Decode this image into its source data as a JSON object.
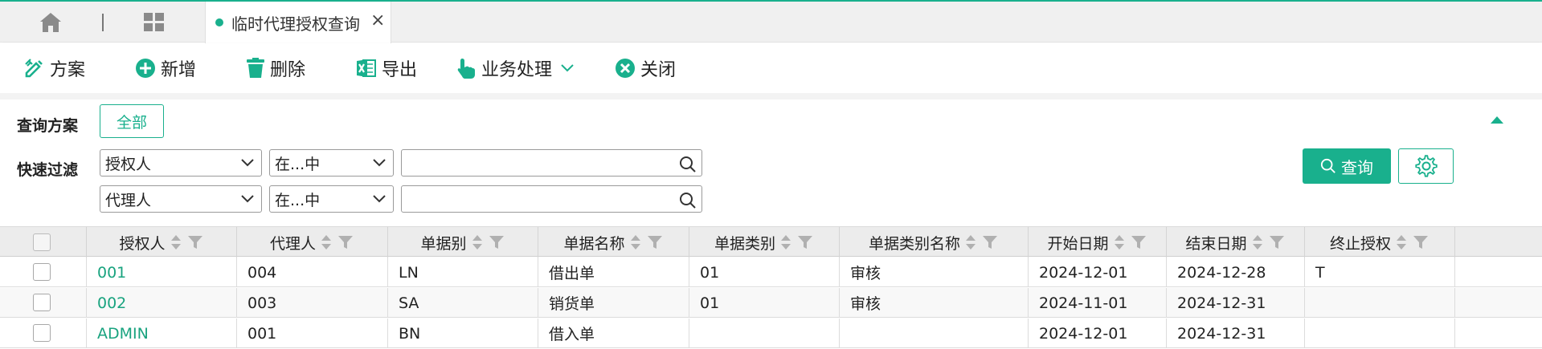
{
  "tabs": {
    "home_icon": "home-icon",
    "apps_icon": "grid-icon",
    "active": {
      "title": "临时代理授权查询",
      "close": "×"
    }
  },
  "toolbar": {
    "scheme": "方案",
    "add": "新增",
    "delete": "删除",
    "export": "导出",
    "business": "业务处理",
    "close": "关闭"
  },
  "filter": {
    "scheme_label": "查询方案",
    "scheme_all": "全部",
    "quick_label": "快速过滤",
    "rows": [
      {
        "field": "授权人",
        "operator": "在...中",
        "value": ""
      },
      {
        "field": "代理人",
        "operator": "在...中",
        "value": ""
      }
    ],
    "query_button": "查询"
  },
  "table": {
    "columns": [
      "授权人",
      "代理人",
      "单据别",
      "单据名称",
      "单据类别",
      "单据类别名称",
      "开始日期",
      "结束日期",
      "终止授权"
    ],
    "rows": [
      [
        "001",
        "004",
        "LN",
        "借出单",
        "01",
        "审核",
        "2024-12-01",
        "2024-12-28",
        "T"
      ],
      [
        "002",
        "003",
        "SA",
        "销货单",
        "01",
        "审核",
        "2024-11-01",
        "2024-12-31",
        ""
      ],
      [
        "ADMIN",
        "001",
        "BN",
        "借入单",
        "",
        "",
        "2024-12-01",
        "2024-12-31",
        ""
      ]
    ]
  },
  "colors": {
    "accent": "#19b08d",
    "link": "#19a37f"
  }
}
